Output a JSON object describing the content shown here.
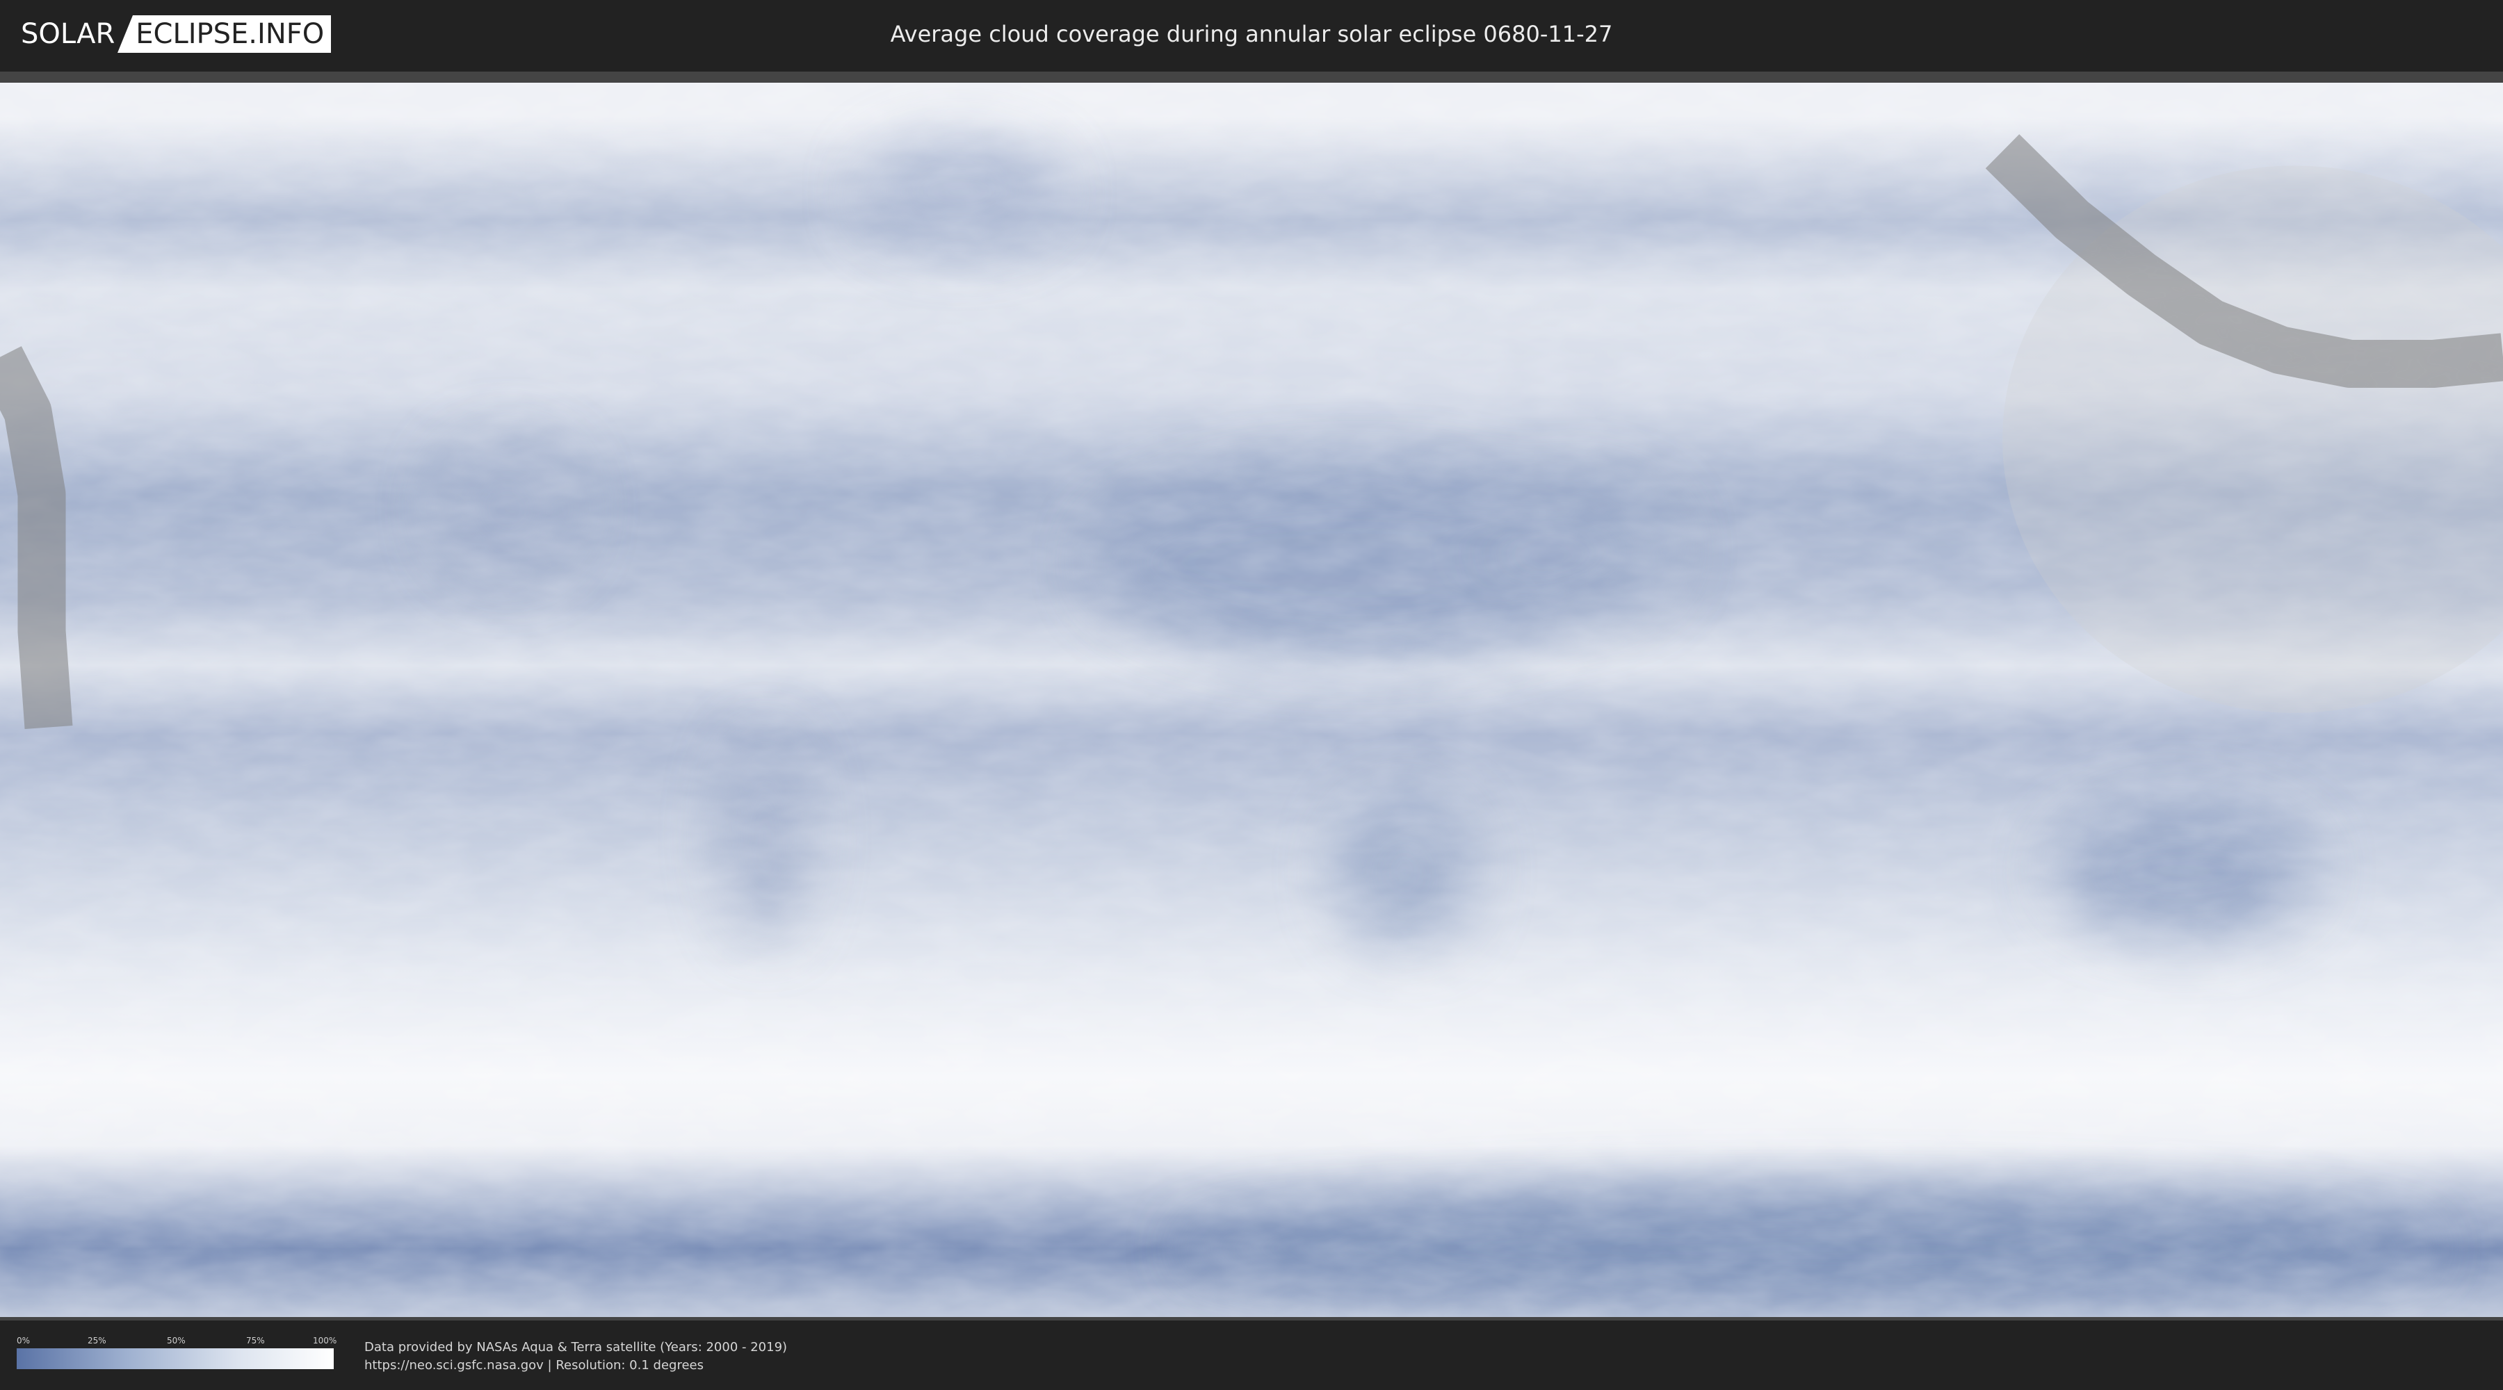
{
  "header": {
    "logo_left": "SOLAR",
    "logo_right": "ECLIPSE.INFO",
    "title": "Average cloud coverage during annular solar eclipse 0680-11-27"
  },
  "map": {
    "colors": {
      "clear_sky": "#5a73a6",
      "cloud": "#ffffff",
      "eclipse_path": "#7f7f7f"
    },
    "bands": [
      {
        "lat": 85,
        "value": 0.9
      },
      {
        "lat": 70,
        "value": 0.55
      },
      {
        "lat": 60,
        "value": 0.8
      },
      {
        "lat": 45,
        "value": 0.75
      },
      {
        "lat": 30,
        "value": 0.45
      },
      {
        "lat": 15,
        "value": 0.55
      },
      {
        "lat": 5,
        "value": 0.8
      },
      {
        "lat": -5,
        "value": 0.5
      },
      {
        "lat": -20,
        "value": 0.65
      },
      {
        "lat": -40,
        "value": 0.85
      },
      {
        "lat": -55,
        "value": 0.95
      },
      {
        "lat": -65,
        "value": 0.9
      },
      {
        "lat": -80,
        "value": 0.2
      },
      {
        "lat": -90,
        "value": 0.6
      }
    ],
    "dry_regions": [
      {
        "name": "sahara",
        "lon": 15,
        "lat": 20,
        "rx": 38,
        "ry": 14,
        "value": 0.35
      },
      {
        "name": "arabia",
        "lon": 47,
        "lat": 22,
        "rx": 14,
        "ry": 10,
        "value": 0.4
      },
      {
        "name": "australia",
        "lon": 134,
        "lat": -25,
        "rx": 19,
        "ry": 10,
        "value": 0.35
      },
      {
        "name": "southern-africa",
        "lon": 22,
        "lat": -25,
        "rx": 10,
        "ry": 11,
        "value": 0.4
      },
      {
        "name": "mexico",
        "lon": -107,
        "lat": 28,
        "rx": 10,
        "ry": 10,
        "value": 0.45
      },
      {
        "name": "andes",
        "lon": -70,
        "lat": -20,
        "rx": 6,
        "ry": 15,
        "value": 0.45
      },
      {
        "name": "greenland",
        "lon": -42,
        "lat": 74,
        "rx": 14,
        "ry": 8,
        "value": 0.5
      },
      {
        "name": "antarctica-east",
        "lon": 80,
        "lat": -80,
        "rx": 90,
        "ry": 8,
        "value": 0.25
      }
    ],
    "eclipse": {
      "type": "annular",
      "path_lonlat": [
        [
          108,
          80
        ],
        [
          118,
          70
        ],
        [
          128,
          62
        ],
        [
          138,
          55
        ],
        [
          148,
          51
        ],
        [
          158,
          49
        ],
        [
          170,
          49
        ],
        [
          180,
          50
        ]
      ],
      "path_width_deg": 7,
      "wrap_path_lonlat": [
        [
          -180,
          50
        ],
        [
          -176,
          42
        ],
        [
          -174,
          30
        ],
        [
          -174,
          10
        ],
        [
          -173,
          -4
        ]
      ],
      "penumbra_center_lonlat": [
        150,
        38
      ],
      "penumbra_radius_deg": 42
    }
  },
  "legend": {
    "ticks": [
      "0%",
      "25%",
      "50%",
      "75%",
      "100%"
    ]
  },
  "credits": {
    "line1": "Data provided by NASAs Aqua & Terra satellite (Years: 2000 - 2019)",
    "line2": "https://neo.sci.gsfc.nasa.gov | Resolution: 0.1 degrees"
  }
}
